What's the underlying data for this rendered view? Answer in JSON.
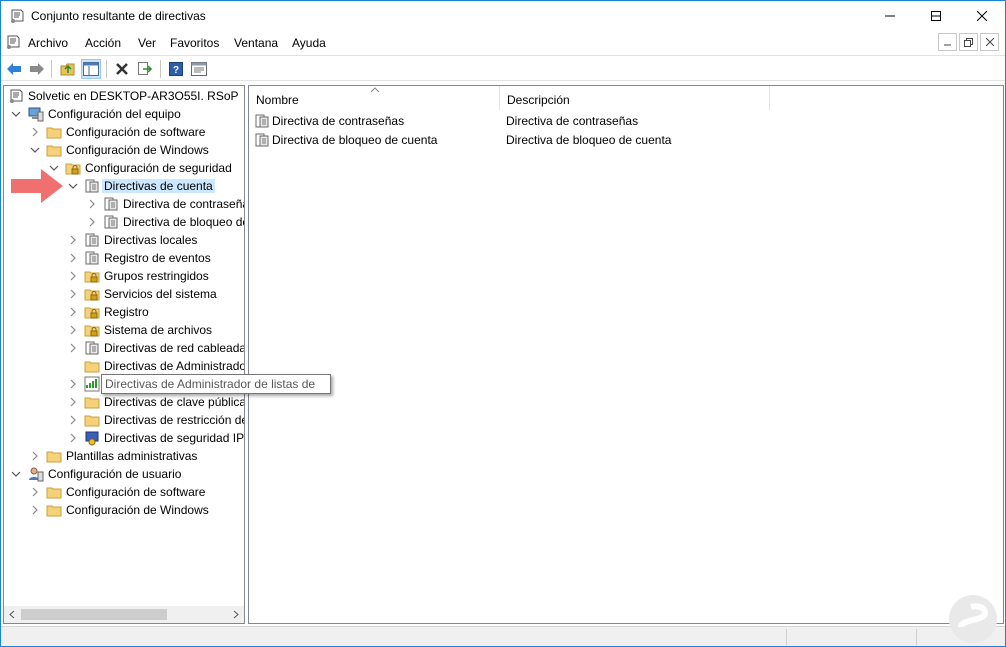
{
  "window": {
    "title": "Conjunto resultante de directivas",
    "controls": {
      "minimize": "minimize",
      "maximize": "maximize",
      "close": "close"
    }
  },
  "menu": {
    "items": [
      "Archivo",
      "Acción",
      "Ver",
      "Favoritos",
      "Ventana",
      "Ayuda"
    ]
  },
  "tree": {
    "root": "Solvetic en DESKTOP-AR3O55I. RSoP",
    "computer_config": "Configuración del equipo",
    "software_settings": "Configuración de software",
    "windows_settings": "Configuración de Windows",
    "security_settings": "Configuración de seguridad",
    "account_policies": "Directivas de cuenta",
    "password_policy": "Directiva de contraseñas",
    "lockout_policy": "Directiva de bloqueo de cuenta",
    "local_policies": "Directivas locales",
    "event_log": "Registro de eventos",
    "restricted_groups": "Grupos restringidos",
    "system_services": "Servicios del sistema",
    "registry": "Registro",
    "file_system": "Sistema de archivos",
    "wired_network": "Directivas de red cableada",
    "admin_policies": "Directivas de Administrador",
    "network_list": "Directivas de Administrador de listas de",
    "public_key": "Directivas de clave pública",
    "software_restriction": "Directivas de restricción de",
    "ip_security": "Directivas de seguridad IP",
    "admin_templates": "Plantillas administrativas",
    "user_config": "Configuración de usuario",
    "user_software_settings": "Configuración de software",
    "user_windows_settings": "Configuración de Windows"
  },
  "tooltip": "Directivas de Administrador de listas de",
  "list": {
    "columns": {
      "name": "Nombre",
      "description": "Descripción"
    },
    "rows": [
      {
        "name": "Directiva de contraseñas",
        "description": "Directiva de contraseñas"
      },
      {
        "name": "Directiva de bloqueo de cuenta",
        "description": "Directiva de bloqueo de cuenta"
      }
    ]
  },
  "colors": {
    "accent": "#1883d7",
    "selection": "#cce8ff",
    "arrow": "#f07070",
    "folder": "#f5d27a"
  }
}
